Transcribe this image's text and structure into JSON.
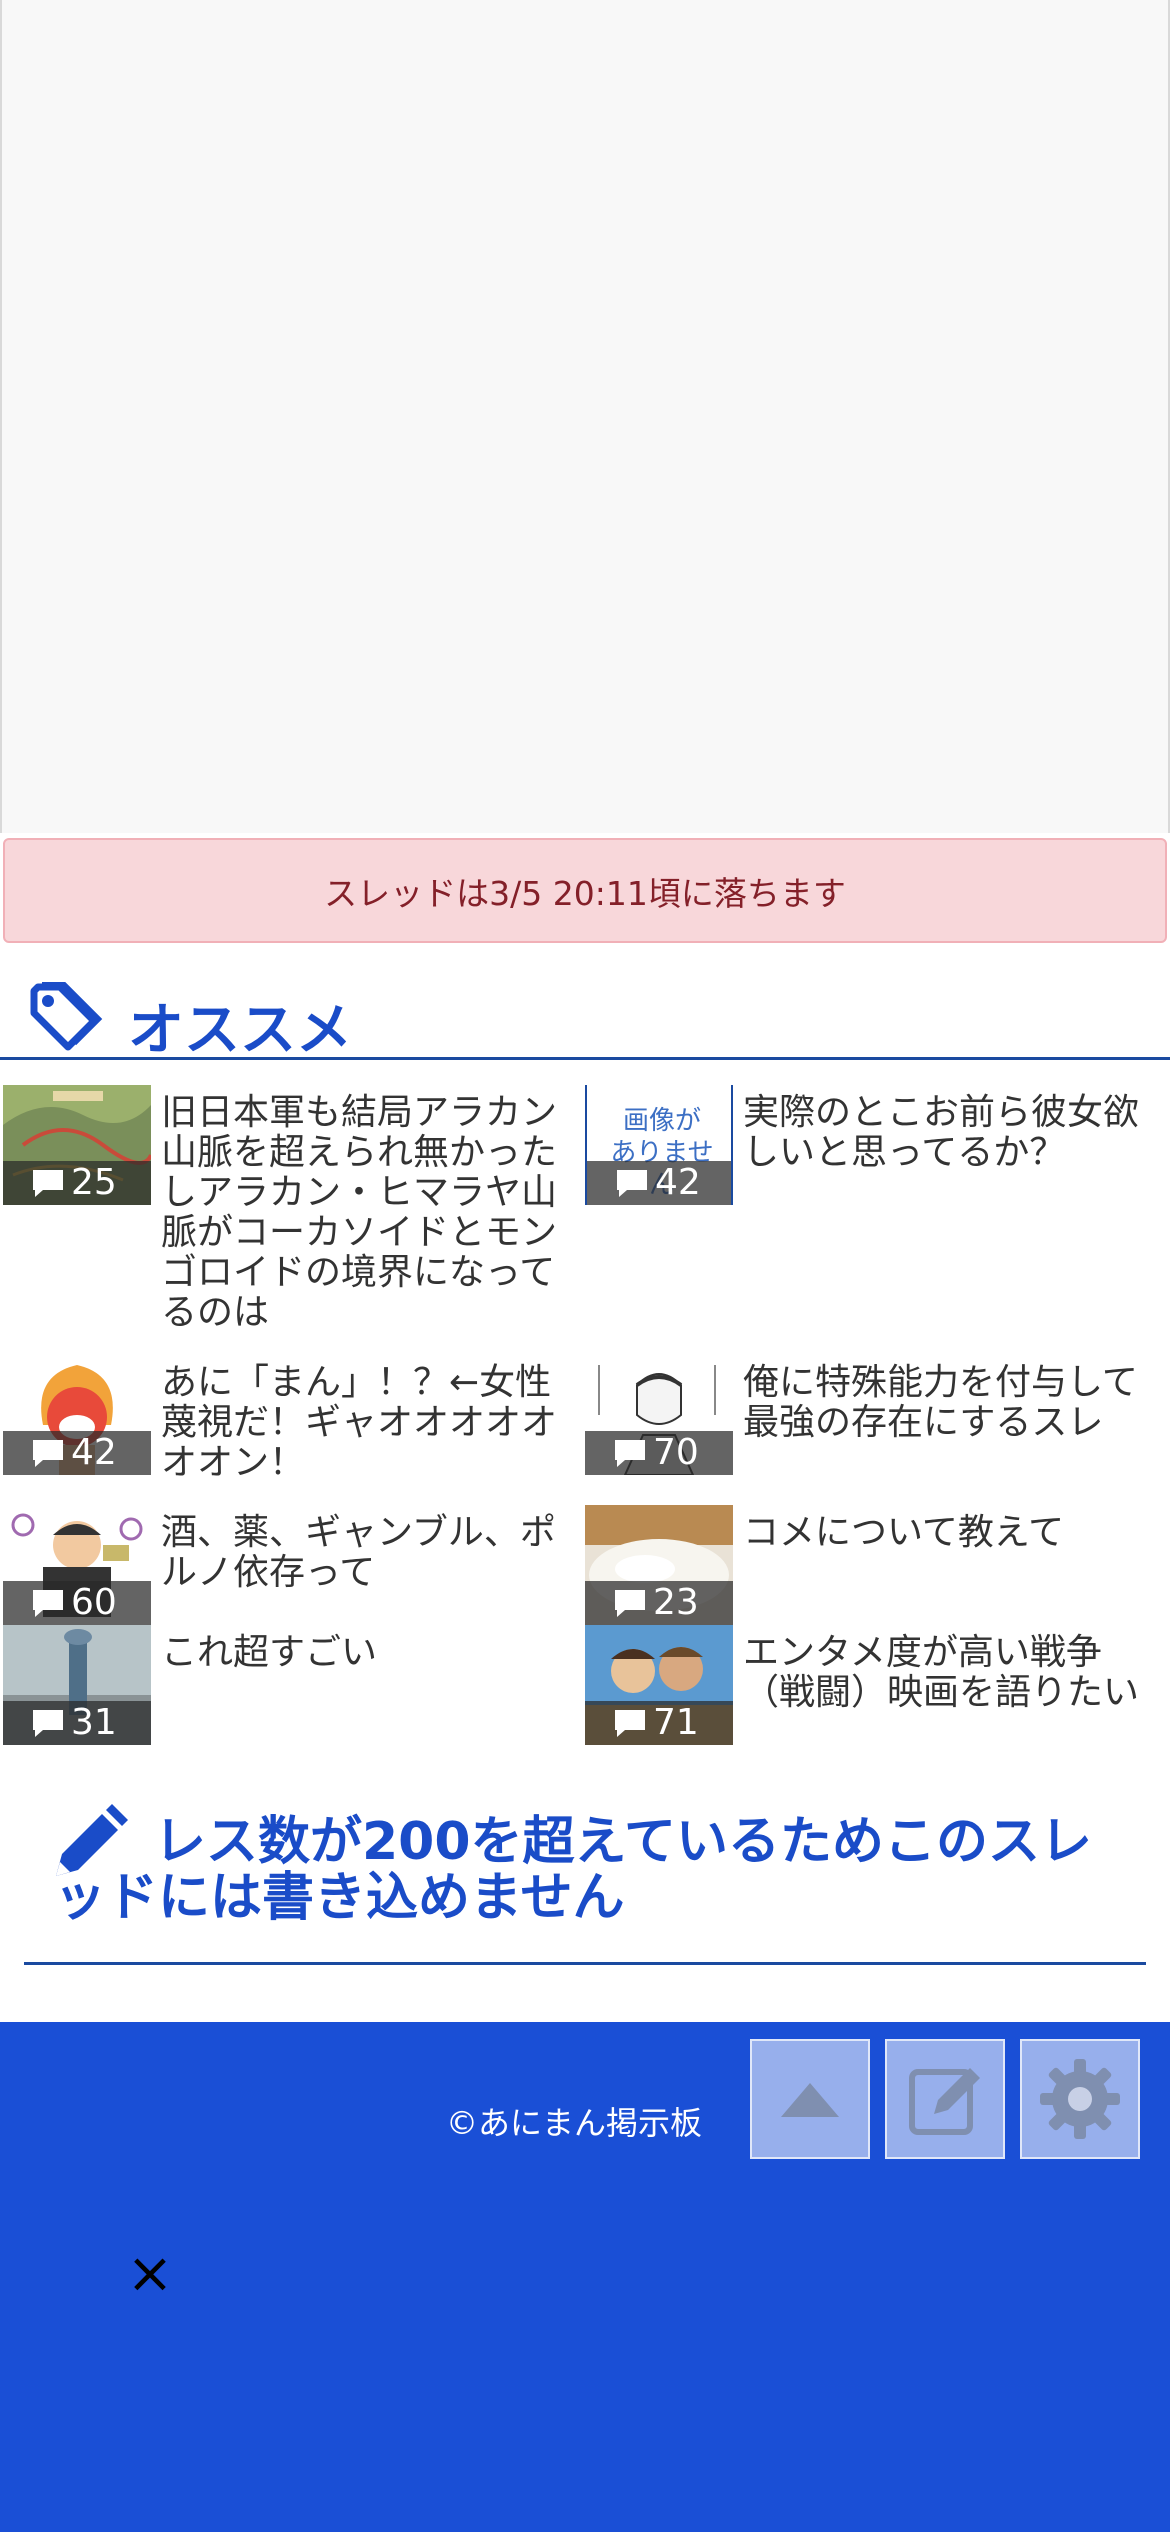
{
  "notice": {
    "text": "スレッドは3/5 20:11頃に落ちます"
  },
  "recommended": {
    "title": "オススメ",
    "items": [
      {
        "count": "25",
        "title": "旧日本軍も結局アラカン山脈を超えられ無かったしアラカン・ヒマラヤ山脈がコーカソイドとモンゴロイドの境界になってるのは",
        "thumb": "map"
      },
      {
        "count": "42",
        "title": "実際のとこお前ら彼女欲しいと思ってるか？",
        "thumb": "noimage",
        "thumb_text": "画像が ありません"
      },
      {
        "count": "42",
        "title": "あに「まん」！？←女性蔑視だ！ギャオオオオオオオン！",
        "thumb": "angry"
      },
      {
        "count": "70",
        "title": "俺に特殊能力を付与して最強の存在にするスレ",
        "thumb": "manga"
      },
      {
        "count": "60",
        "title": "酒、薬、ギャンブル、ポルノ依存って",
        "thumb": "addict"
      },
      {
        "count": "23",
        "title": "コメについて教えて",
        "thumb": "rice"
      },
      {
        "count": "31",
        "title": "これ超すごい",
        "thumb": "pole"
      },
      {
        "count": "71",
        "title": "エンタメ度が高い戦争（戦闘）映画を語りたい",
        "thumb": "movie"
      }
    ]
  },
  "closed": {
    "text": "レス数が200を超えているためこのスレッドには書き込めません"
  },
  "footer": {
    "copyright": "©あにまん掲示板",
    "buttons": [
      "scroll-top",
      "write",
      "settings"
    ]
  },
  "close_label": "×",
  "colors": {
    "accent": "#1a4cc8",
    "footer": "#1a4fd6",
    "notice_bg": "#f8d7da"
  }
}
